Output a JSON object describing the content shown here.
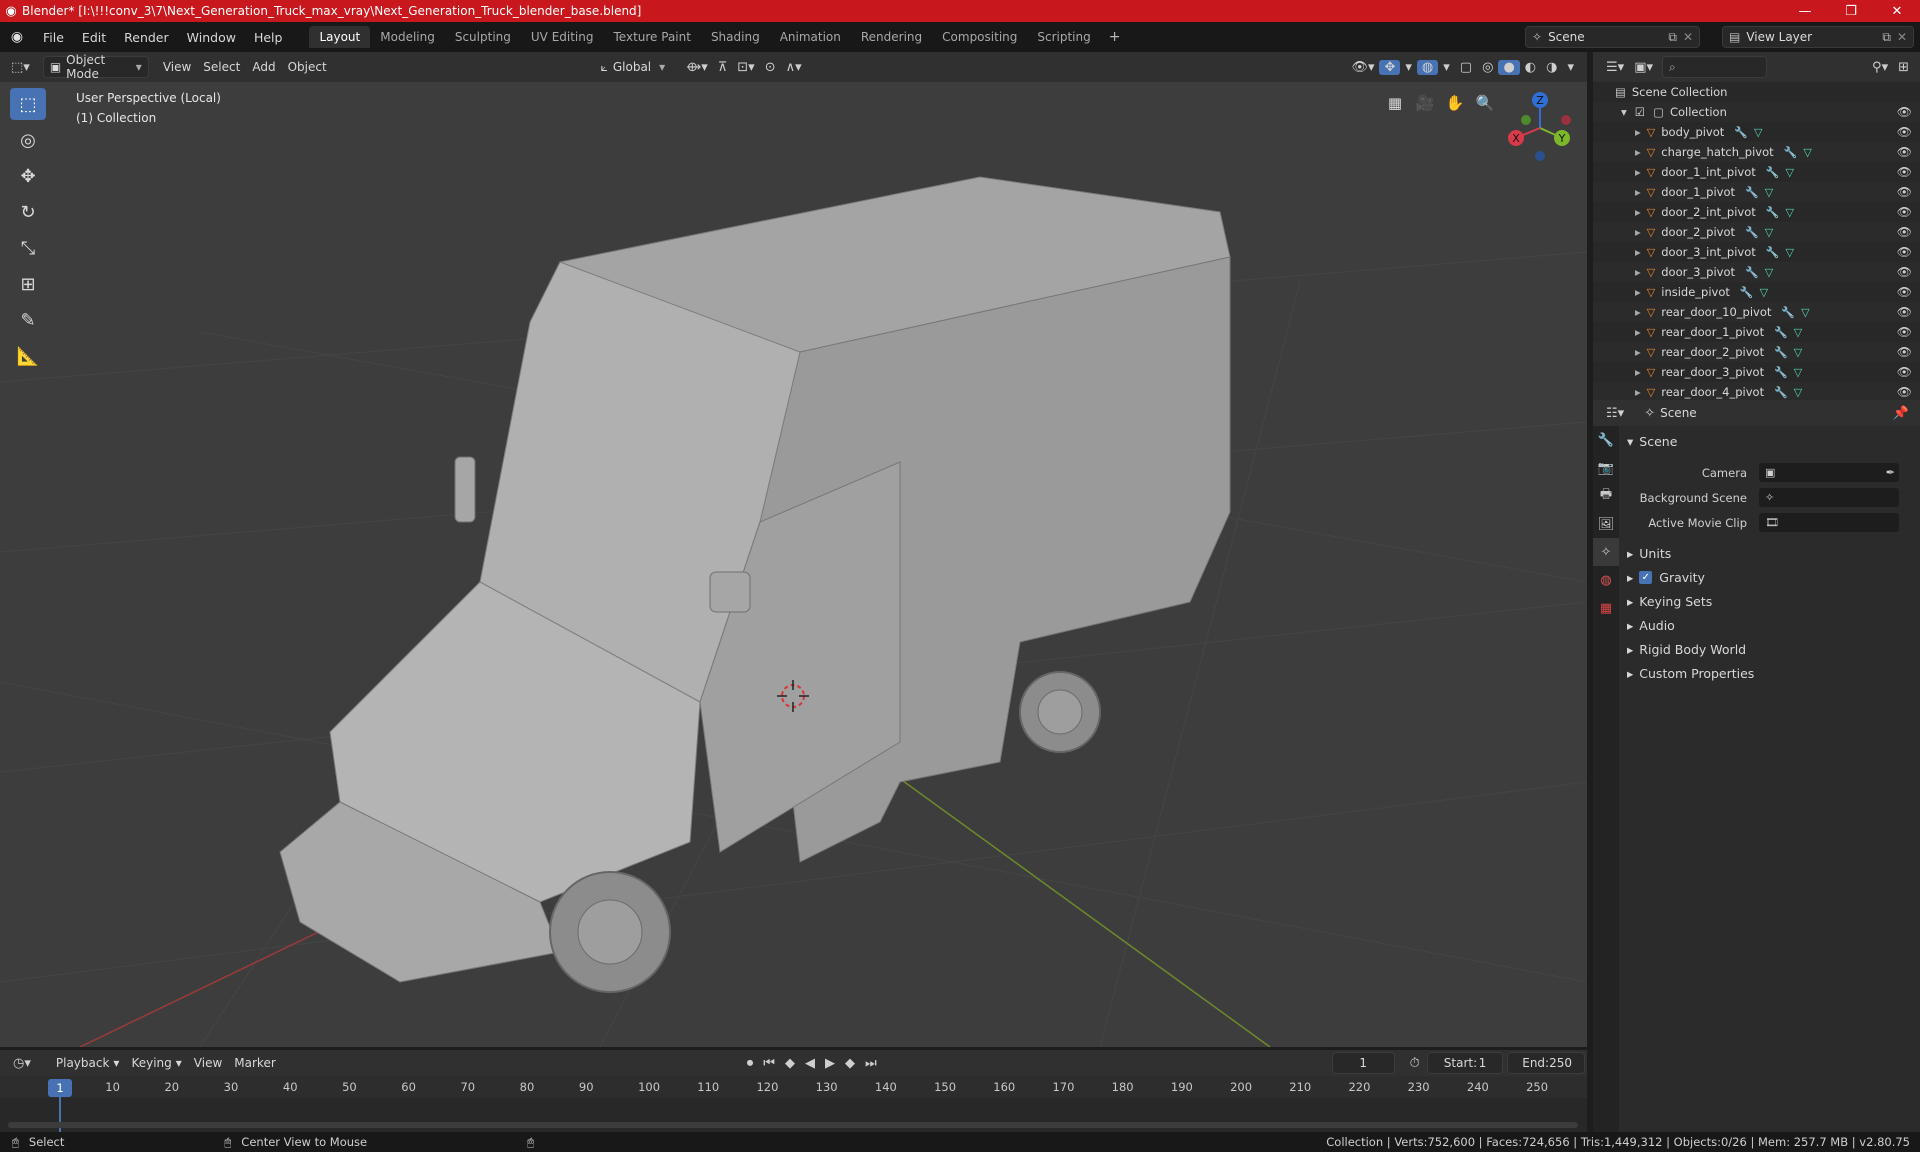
{
  "window": {
    "title": "Blender* [I:\\!!!conv_3\\7\\Next_Generation_Truck_max_vray\\Next_Generation_Truck_blender_base.blend]",
    "min": "—",
    "max": "❐",
    "close": "✕"
  },
  "menu": [
    "File",
    "Edit",
    "Render",
    "Window",
    "Help"
  ],
  "workspaces": [
    "Layout",
    "Modeling",
    "Sculpting",
    "UV Editing",
    "Texture Paint",
    "Shading",
    "Animation",
    "Rendering",
    "Compositing",
    "Scripting"
  ],
  "active_workspace": "Layout",
  "scene_name": "Scene",
  "view_layer": "View Layer",
  "viewport_header": {
    "mode": "Object Mode",
    "menus": [
      "View",
      "Select",
      "Add",
      "Object"
    ],
    "transform": "Global"
  },
  "viewport": {
    "line1": "User Perspective (Local)",
    "line2": "(1) Collection",
    "gizmo": {
      "z": "Z",
      "y": "Y",
      "x": "X"
    }
  },
  "outliner": {
    "root": "Scene Collection",
    "collection": "Collection",
    "items": [
      "body_pivot",
      "charge_hatch_pivot",
      "door_1_int_pivot",
      "door_1_pivot",
      "door_2_int_pivot",
      "door_2_pivot",
      "door_3_int_pivot",
      "door_3_pivot",
      "inside_pivot",
      "rear_door_10_pivot",
      "rear_door_1_pivot",
      "rear_door_2_pivot",
      "rear_door_3_pivot",
      "rear_door_4_pivot"
    ]
  },
  "properties": {
    "header": "Scene",
    "section": "Scene",
    "fields": [
      {
        "label": "Camera",
        "value": ""
      },
      {
        "label": "Background Scene",
        "value": ""
      },
      {
        "label": "Active Movie Clip",
        "value": ""
      }
    ],
    "subsections": [
      "Units",
      "Gravity",
      "Keying Sets",
      "Audio",
      "Rigid Body World",
      "Custom Properties"
    ]
  },
  "timeline": {
    "menus": [
      "Playback",
      "Keying",
      "View",
      "Marker"
    ],
    "current_frame": "1",
    "start_label": "Start:",
    "start": "1",
    "end_label": "End:",
    "end": "250",
    "ticks": [
      "10",
      "20",
      "30",
      "40",
      "50",
      "60",
      "70",
      "80",
      "90",
      "100",
      "110",
      "120",
      "130",
      "140",
      "150",
      "160",
      "170",
      "180",
      "190",
      "200",
      "210",
      "220",
      "230",
      "240",
      "250"
    ]
  },
  "status": {
    "select": "Select",
    "center": "Center View to Mouse",
    "stats": "Collection | Verts:752,600 | Faces:724,656 | Tris:1,449,312 | Objects:0/26 | Mem: 257.7 MB | v2.80.75"
  },
  "colors": {
    "accent": "#4772b3",
    "titlebar": "#c8181e",
    "object_icon": "#e8892d",
    "mesh_icon": "#55d8b5"
  }
}
